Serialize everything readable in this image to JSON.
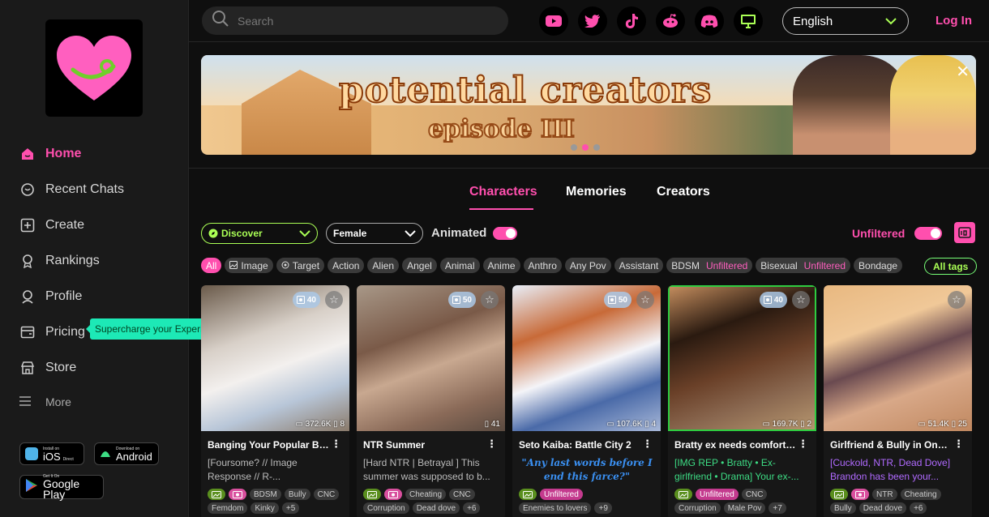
{
  "colors": {
    "accent": "#ff4fae",
    "teal": "#1de9b6",
    "green": "#aaff55"
  },
  "sidebar": {
    "items": [
      {
        "label": "Home",
        "icon": "home-icon"
      },
      {
        "label": "Recent Chats",
        "icon": "chat-icon"
      },
      {
        "label": "Create",
        "icon": "plus-square-icon"
      },
      {
        "label": "Rankings",
        "icon": "trophy-icon"
      },
      {
        "label": "Profile",
        "icon": "user-icon"
      },
      {
        "label": "Pricing",
        "icon": "wallet-icon"
      },
      {
        "label": "Store",
        "icon": "store-icon"
      }
    ],
    "tooltip": "Supercharge your Experience",
    "more": "More",
    "ios": {
      "small1": "Install on",
      "big": "iOS",
      "small2": "Direct"
    },
    "android": {
      "small": "Download on",
      "big": "Android"
    },
    "play": {
      "small": "Get It On",
      "big": "Google Play"
    }
  },
  "header": {
    "search_placeholder": "Search",
    "language": "English",
    "login": "Log In"
  },
  "banner": {
    "title": "potential creators",
    "subtitle": "episode III"
  },
  "tabs": [
    "Characters",
    "Memories",
    "Creators"
  ],
  "filters": {
    "discover": "Discover",
    "gender": "Female",
    "animated": "Animated",
    "unfiltered": "Unfiltered"
  },
  "tags": [
    {
      "label": "All"
    },
    {
      "label": "Image",
      "icon": "image"
    },
    {
      "label": "Target",
      "icon": "target"
    },
    {
      "label": "Action"
    },
    {
      "label": "Alien"
    },
    {
      "label": "Angel"
    },
    {
      "label": "Animal"
    },
    {
      "label": "Anime"
    },
    {
      "label": "Anthro"
    },
    {
      "label": "Any Pov"
    },
    {
      "label": "Assistant"
    },
    {
      "label": "BDSM",
      "sub": "Unfiltered"
    },
    {
      "label": "Bisexual",
      "sub": "Unfiltered"
    },
    {
      "label": "Bondage"
    }
  ],
  "all_tags": "All tags",
  "cards": [
    {
      "title": "Banging Your Popular Bu...",
      "img_count": "40",
      "views": "372.6K",
      "memories": "8",
      "desc": "[Foursome? // Image Response // R-...",
      "desc_style": "plain",
      "tags": [
        "BDSM",
        "Bully",
        "CNC",
        "Femdom",
        "Kinky",
        "+5"
      ]
    },
    {
      "title": "NTR Summer",
      "img_count": "50",
      "views": "",
      "memories": "41",
      "desc": "[Hard NTR | Betrayal ] This summer was supposed to b...",
      "desc_style": "plain",
      "tags": [
        "Cheating",
        "CNC",
        "Corruption",
        "Dead dove",
        "+6"
      ]
    },
    {
      "title": "Seto Kaiba: Battle City 2",
      "img_count": "50",
      "views": "107.6K",
      "memories": "4",
      "desc": "\"Any last words before I end this farce?\"",
      "desc_style": "blue",
      "tags": [
        "Unfiltered",
        "Enemies to lovers",
        "+9"
      ]
    },
    {
      "title": "Bratty ex needs comfort ...",
      "img_count": "40",
      "views": "169.7K",
      "memories": "2",
      "desc": "[IMG REP • Bratty • Ex-girlfriend • Drama] Your ex-...",
      "desc_style": "green",
      "tags": [
        "Unfiltered",
        "CNC",
        "Corruption",
        "Male Pov",
        "+7"
      ]
    },
    {
      "title": "Girlfriend & Bully in One ...",
      "img_count": "",
      "views": "51.4K",
      "memories": "25",
      "desc": "[Cuckold, NTR, Dead Dove] Brandon has been your...",
      "desc_style": "purple",
      "tags": [
        "NTR",
        "Cheating",
        "Bully",
        "Dead dove",
        "+6"
      ]
    }
  ]
}
